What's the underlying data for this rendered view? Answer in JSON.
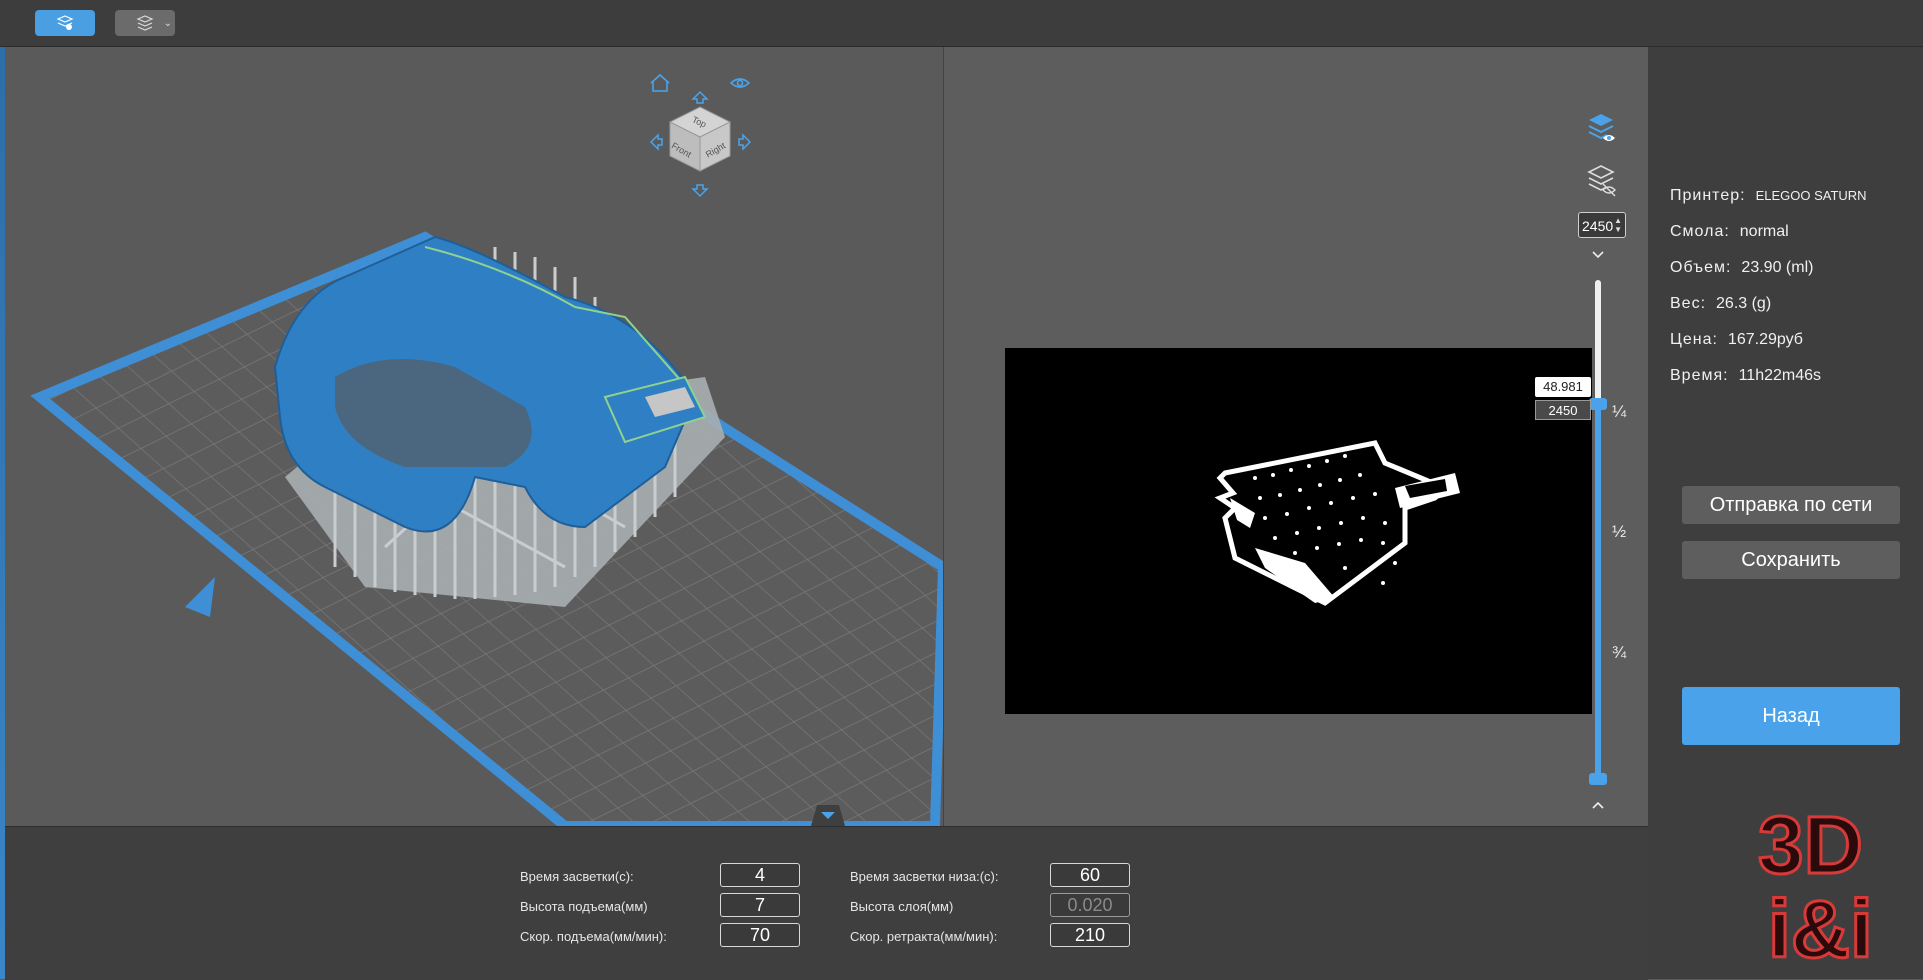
{
  "toolbar": {
    "slice_icon": "slice-layers-icon",
    "layers_icon": "layers-settings-icon",
    "dropdown_glyph": "⌄"
  },
  "viewcube": {
    "top": "Top",
    "front": "Front",
    "right": "Right"
  },
  "slice_preview": {
    "current_layer": "2450",
    "tooltip_height": "48.981",
    "tooltip_layer": "2450",
    "marks": [
      "¼",
      "½",
      "¾"
    ],
    "progress": 0.76
  },
  "params": {
    "exposure_time_label": "Время засветки(с):",
    "exposure_time_value": "4",
    "lift_height_label": "Высота подъема(мм)",
    "lift_height_value": "7",
    "lift_speed_label": "Скор. подъема(мм/мин):",
    "lift_speed_value": "70",
    "bottom_exposure_label": "Время засветки низа:(с):",
    "bottom_exposure_value": "60",
    "layer_height_label": "Высота слоя(мм)",
    "layer_height_value": "0.020",
    "retract_speed_label": "Скор. ретракта(мм/мин):",
    "retract_speed_value": "210"
  },
  "info": {
    "printer_label": "Принтер:",
    "printer_value": "ELEGOO SATURN",
    "resin_label": "Смола:",
    "resin_value": "normal",
    "volume_label": "Объем:",
    "volume_value": "23.90  (ml)",
    "weight_label": "Вес:",
    "weight_value": "26.3  (g)",
    "price_label": "Цена:",
    "price_value": "167.29руб",
    "time_label": "Время:",
    "time_value": "11h22m46s",
    "send_network_label": "Отправка по сети",
    "save_label": "Сохранить",
    "back_label": "Назад"
  },
  "watermark": {
    "line1": "3D",
    "line2": "i&i"
  },
  "colors": {
    "accent": "#4aa3ea",
    "model_blue": "#2f7fc4",
    "support_grey": "#b8bcbf",
    "panel_dark": "#3e3e3e"
  }
}
